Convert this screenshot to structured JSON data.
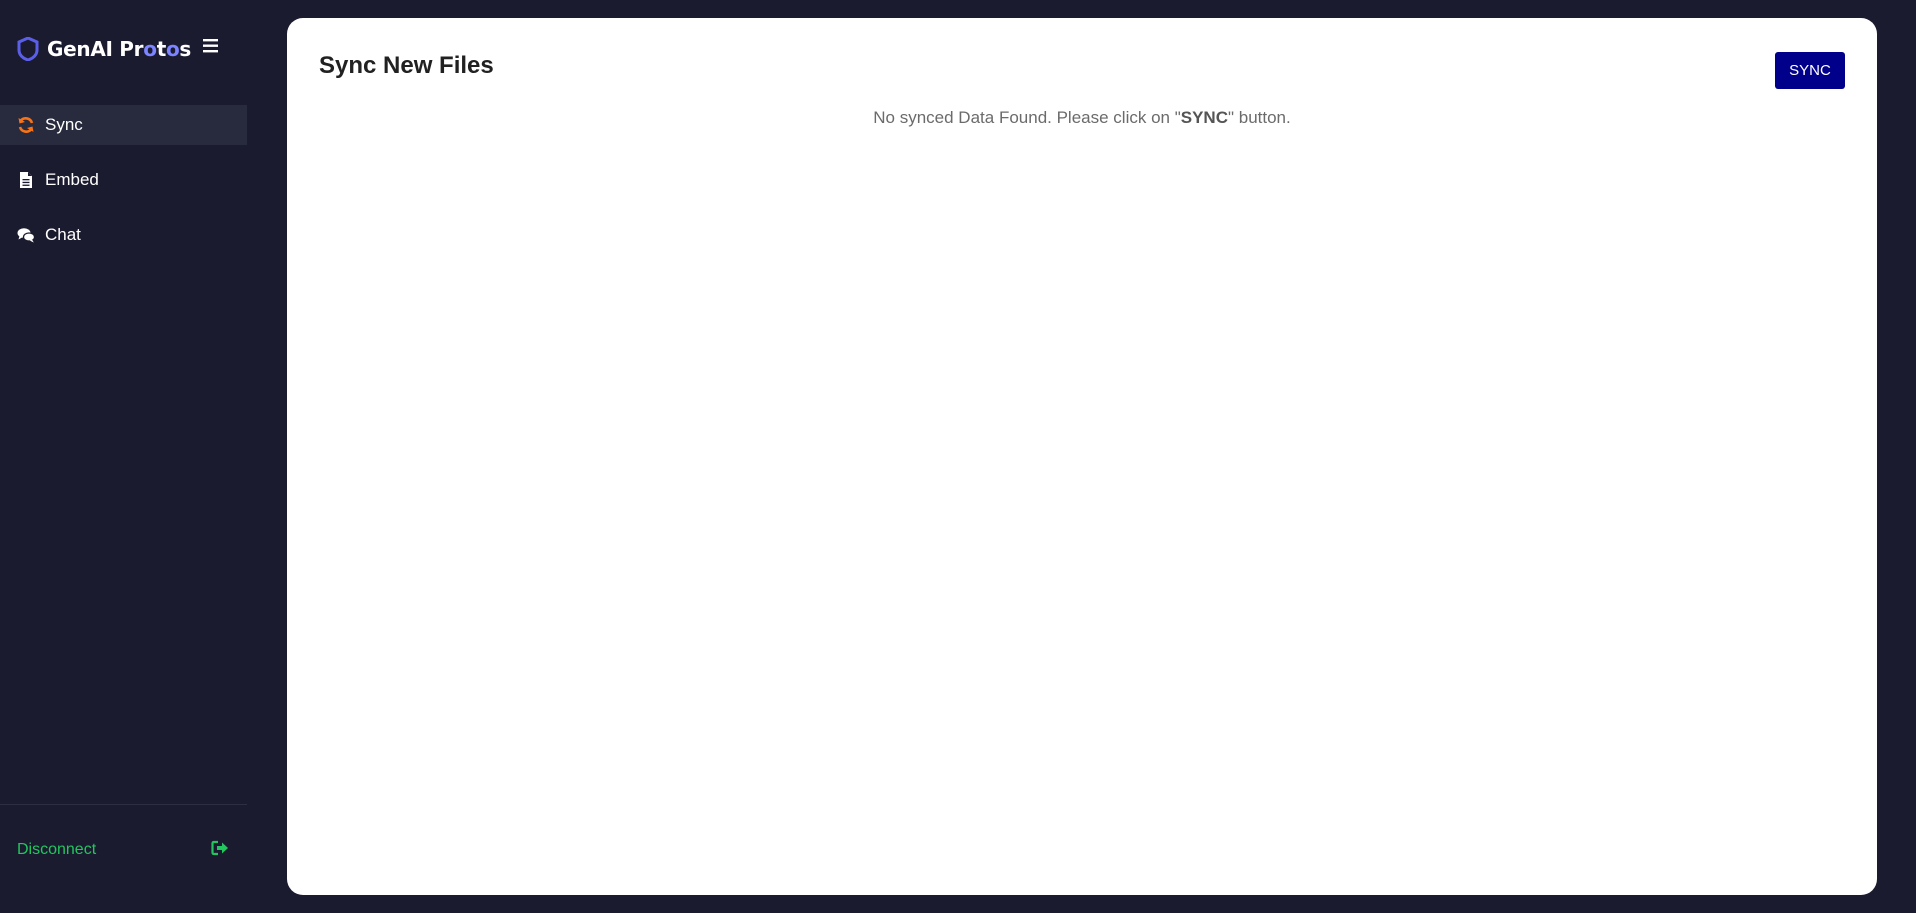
{
  "brand": {
    "name_prefix": "GenAI Pr",
    "o1": "o",
    "mid": "t",
    "o2": "o",
    "name_suffix": "s",
    "accent_color": "#5b5fe8"
  },
  "sidebar": {
    "menu_icon": "hamburger-icon",
    "items": [
      {
        "label": "Sync",
        "icon": "refresh-icon",
        "active": true,
        "icon_color": "#f97316"
      },
      {
        "label": "Embed",
        "icon": "document-icon",
        "active": false
      },
      {
        "label": "Chat",
        "icon": "chat-bubbles-icon",
        "active": false
      }
    ],
    "disconnect": {
      "label": "Disconnect",
      "icon": "sign-out-icon",
      "color": "#22c55e"
    }
  },
  "main": {
    "title": "Sync New Files",
    "sync_button_label": "SYNC",
    "empty_message": {
      "before": "No synced Data Found. Please click on \"",
      "strong": "SYNC",
      "after": "\" button."
    }
  }
}
